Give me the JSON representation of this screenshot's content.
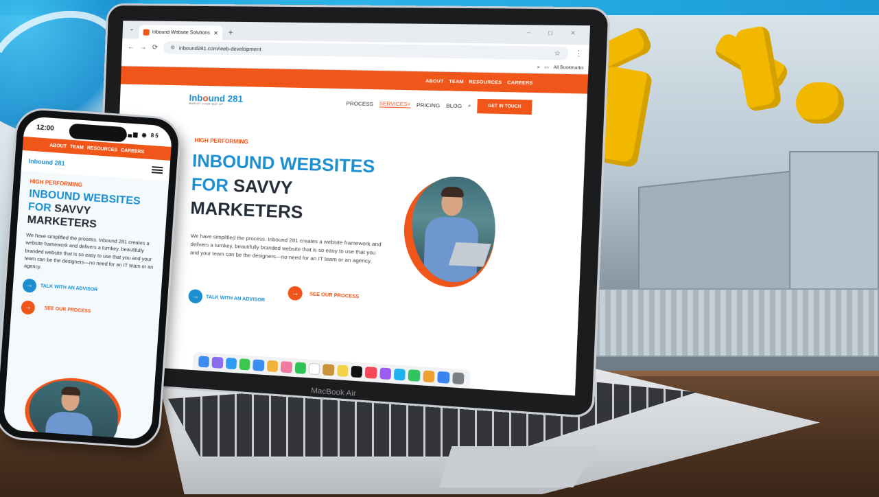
{
  "browser": {
    "tab_title": "Inbound Website Solutions and",
    "tab_close": "✕",
    "new_tab": "+",
    "url": "inbound281.com/web-development",
    "bookmarks_label": "All Bookmarks",
    "window_controls": "– ◻ ✕"
  },
  "site": {
    "topbar": [
      "ABOUT",
      "TEAM",
      "RESOURCES",
      "CAREERS"
    ],
    "logo": {
      "prefix": "Inb",
      "accent": "o",
      "suffix": "und 281",
      "tagline": "MARKET YOUR WAY UP"
    },
    "nav": {
      "process": "PROCESS",
      "services": "SERVICES",
      "pricing": "PRICING",
      "blog": "BLOG",
      "cta": "GET IN TOUCH"
    },
    "hero": {
      "eyebrow": "HIGH PERFORMING",
      "headline_line1": "INBOUND WEBSITES",
      "headline_for": "FOR",
      "headline_savvy": "SAVVY",
      "headline_line3": "MARKETERS",
      "lede": "We have simplified the process. Inbound 281 creates a website framework and delivers a turnkey, beautifully branded website that is so easy to use that you and your team can be the designers—no need for an IT team or an agency.",
      "btn_advisor": "TALK WITH AN ADVISOR",
      "btn_process": "SEE OUR PROCESS"
    }
  },
  "device": {
    "laptop_brand": "MacBook Air"
  },
  "phone": {
    "time": "12:00",
    "status_right": "▂▄▆ ◉ 85",
    "logo_word": "Inbound 281"
  },
  "colors": {
    "brand_orange": "#f0561a",
    "brand_blue": "#1c8fd1",
    "heading_dark": "#242c38"
  }
}
